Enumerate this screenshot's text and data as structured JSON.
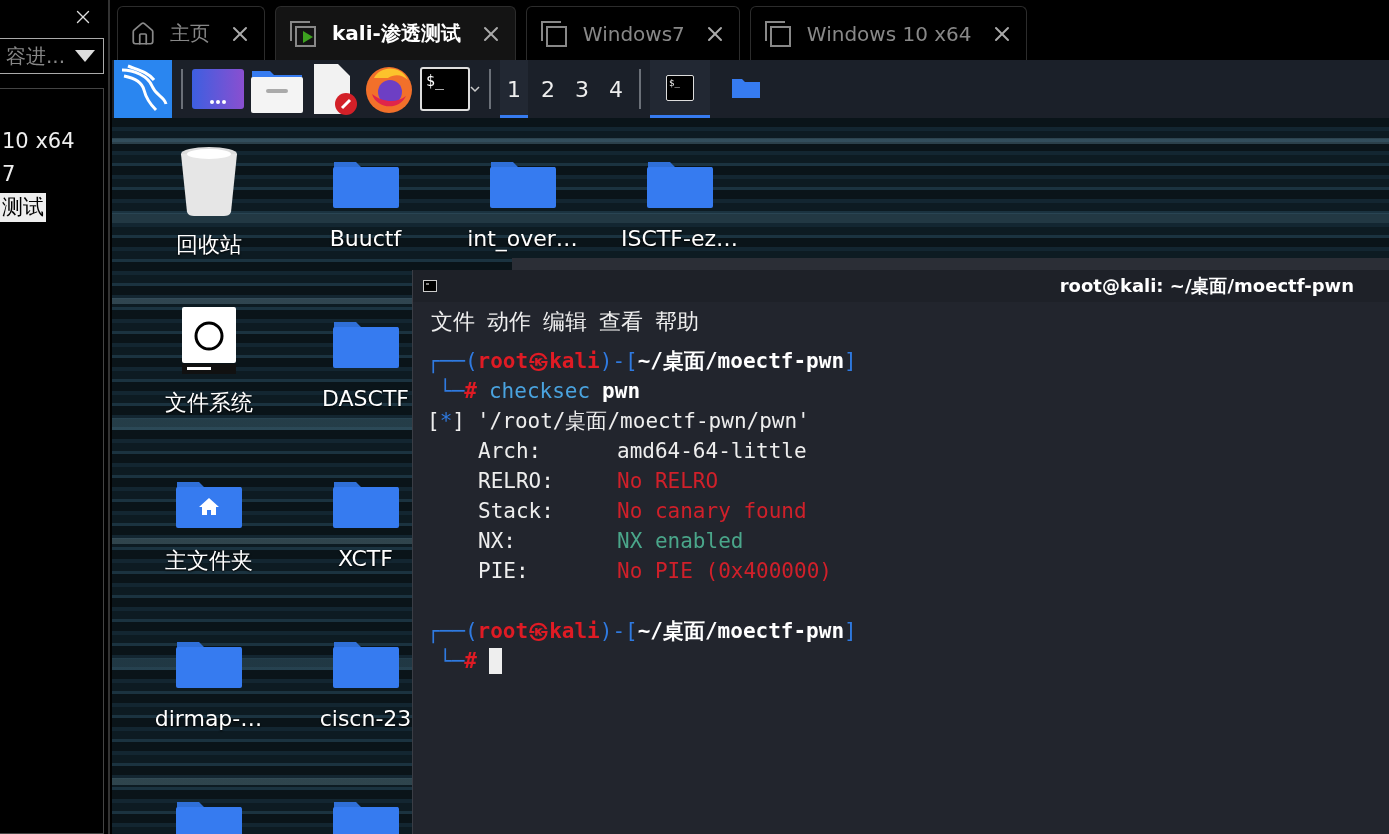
{
  "library_panel": {
    "filter": "容进...",
    "items": [
      {
        "label": "10 x64",
        "selected": false
      },
      {
        "label": "7",
        "selected": false
      },
      {
        "label": "测试",
        "selected": true
      }
    ]
  },
  "tabs": [
    {
      "label": "主页",
      "kind": "home",
      "selected": false
    },
    {
      "label": "kali-渗透测试",
      "kind": "vm-running",
      "selected": true
    },
    {
      "label": "Windows7",
      "kind": "vm",
      "selected": false
    },
    {
      "label": "Windows 10 x64",
      "kind": "vm",
      "selected": false
    }
  ],
  "panel": {
    "launchers": [
      {
        "kind": "kali"
      },
      {
        "kind": "workspace"
      },
      {
        "kind": "files"
      },
      {
        "kind": "editor"
      },
      {
        "kind": "firefox"
      },
      {
        "kind": "terminal",
        "glyph": "$_"
      }
    ],
    "workspaces": [
      {
        "label": "1",
        "selected": true
      },
      {
        "label": "2",
        "selected": false
      },
      {
        "label": "3",
        "selected": false
      },
      {
        "label": "4",
        "selected": false
      }
    ],
    "tasks": [
      {
        "kind": "terminal",
        "glyph": "$_",
        "selected": true
      },
      {
        "kind": "folder",
        "selected": false
      }
    ]
  },
  "desktop_columns": [
    [
      {
        "label": "回收站",
        "kind": "trash"
      },
      {
        "label": "文件系统",
        "kind": "drive"
      },
      {
        "label": "主文件夹",
        "kind": "home-folder"
      },
      {
        "label": "dirmap-…",
        "kind": "folder"
      },
      {
        "kind": "folder"
      }
    ],
    [
      {
        "label": "Buuctf",
        "kind": "folder"
      },
      {
        "label": "DASCTF",
        "kind": "folder"
      },
      {
        "label": "XCTF",
        "kind": "folder"
      },
      {
        "label": "ciscn-23",
        "kind": "folder"
      },
      {
        "kind": "folder"
      }
    ],
    [
      {
        "label": "int_over…",
        "kind": "folder"
      }
    ],
    [
      {
        "label": "ISCTF-ez…",
        "kind": "folder"
      }
    ]
  ],
  "terminal": {
    "title": "root@kali: ~/桌面/moectf-pwn",
    "menu": [
      "文件",
      "动作",
      "编辑",
      "查看",
      "帮助"
    ],
    "lines": [
      {
        "kind": "prompt",
        "open": "┌──(",
        "user": "root㉿kali",
        "mid": ")-[",
        "path": "~/桌面/moectf-pwn",
        "close": "]"
      },
      {
        "kind": "command",
        "marker": "└─",
        "hash": "#",
        "command": "checksec",
        "argument": "pwn"
      },
      {
        "kind": "info",
        "open": "[",
        "mark": "*",
        "close": "]",
        "text": "'/root/桌面/moectf-pwn/pwn'"
      },
      {
        "kind": "result",
        "label": "Arch:",
        "value": "amd64-64-little",
        "color": "#eeeeee"
      },
      {
        "kind": "result",
        "label": "RELRO:",
        "value": "No RELRO",
        "color": "#d0202a"
      },
      {
        "kind": "result",
        "label": "Stack:",
        "value": "No canary found",
        "color": "#d0202a"
      },
      {
        "kind": "result",
        "label": "NX:",
        "value": "NX enabled",
        "color": "#4aa68a"
      },
      {
        "kind": "result",
        "label": "PIE:",
        "value": "No PIE (0x400000)",
        "color": "#d0202a"
      },
      {
        "kind": "blank"
      },
      {
        "kind": "prompt",
        "open": "┌──(",
        "user": "root㉿kali",
        "mid": ")-[",
        "path": "~/桌面/moectf-pwn",
        "close": "]"
      },
      {
        "kind": "cursor",
        "marker": "└─",
        "hash": "#"
      }
    ]
  }
}
